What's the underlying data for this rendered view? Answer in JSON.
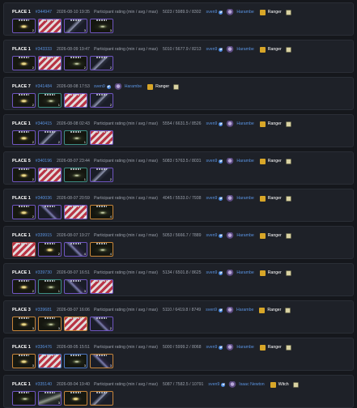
{
  "matches": [
    {
      "place": "PLACE 1",
      "id": "#344947",
      "date": "2026-08-10 19:35",
      "rating_label": "Participant rating (min / avg / max)",
      "rating": "5023 / 5989.9 / 8302",
      "user": "sven9",
      "team": "Harambe",
      "role": "Ranger",
      "items": [
        {
          "kind": "eye",
          "border": "purple",
          "count": "2"
        },
        {
          "kind": "flag",
          "border": "purple",
          "count": ""
        },
        {
          "kind": "blade",
          "border": "purple",
          "count": "3"
        },
        {
          "kind": "scope",
          "border": "purple",
          "count": "3"
        }
      ]
    },
    {
      "place": "PLACE 1",
      "id": "#343333",
      "date": "2026-08-09 19:47",
      "rating_label": "Participant rating (min / avg / max)",
      "rating": "5010 / 5677.9 / 8213",
      "user": "sven9",
      "team": "Harambe",
      "role": "Ranger",
      "items": [
        {
          "kind": "eye",
          "border": "purple",
          "count": "2"
        },
        {
          "kind": "flag",
          "border": "purple",
          "count": ""
        },
        {
          "kind": "scope",
          "border": "purple",
          "count": "2"
        },
        {
          "kind": "blade",
          "border": "purple",
          "count": "2"
        }
      ]
    },
    {
      "place": "PLACE 7",
      "id": "#341484",
      "date": "2026-08-08 17:53",
      "rating_label": "",
      "rating": "",
      "user": "sven9",
      "team": "Harambe",
      "role": "Ranger",
      "items": [
        {
          "kind": "eye",
          "border": "purple",
          "count": "2"
        },
        {
          "kind": "scope",
          "border": "teal",
          "count": "1"
        },
        {
          "kind": "flag",
          "border": "purple",
          "count": ""
        },
        {
          "kind": "blade",
          "border": "purple",
          "count": "2"
        }
      ]
    },
    {
      "place": "PLACE 1",
      "id": "#340415",
      "date": "2026-08-08 02:43",
      "rating_label": "Participant rating (min / avg / max)",
      "rating": "5554 / 6631.5 / 8526",
      "user": "sven9",
      "team": "Harambe",
      "role": "Ranger",
      "items": [
        {
          "kind": "eye",
          "border": "purple",
          "count": "2"
        },
        {
          "kind": "blade",
          "border": "purple",
          "count": "2"
        },
        {
          "kind": "scope",
          "border": "teal",
          "count": "1"
        },
        {
          "kind": "flag",
          "border": "purple",
          "count": "3"
        }
      ]
    },
    {
      "place": "PLACE 5",
      "id": "#340196",
      "date": "2026-08-07 23:44",
      "rating_label": "Participant rating (min / avg / max)",
      "rating": "5083 / 5763.5 / 8031",
      "user": "sven9",
      "team": "Harambe",
      "role": "Ranger",
      "items": [
        {
          "kind": "eye",
          "border": "purple",
          "count": "2"
        },
        {
          "kind": "flag",
          "border": "purple",
          "count": ""
        },
        {
          "kind": "scope",
          "border": "teal",
          "count": "1"
        },
        {
          "kind": "blade",
          "border": "purple",
          "count": "2"
        }
      ]
    },
    {
      "place": "PLACE 1",
      "id": "#340036",
      "date": "2026-08-07 20:59",
      "rating_label": "Participant rating (min / avg / max)",
      "rating": "4045 / 5533.0 / 7938",
      "user": "sven9",
      "team": "Harambe",
      "role": "Ranger",
      "items": [
        {
          "kind": "eye",
          "border": "purple",
          "count": "2"
        },
        {
          "kind": "blade2",
          "border": "purple",
          "count": ""
        },
        {
          "kind": "flag",
          "border": "purple",
          "count": "3"
        },
        {
          "kind": "scope",
          "border": "orange",
          "count": "4"
        }
      ]
    },
    {
      "place": "PLACE 1",
      "id": "#339915",
      "date": "2026-08-07 19:27",
      "rating_label": "Participant rating (min / avg / max)",
      "rating": "5053 / 5666.7 / 7889",
      "user": "sven9",
      "team": "Harambe",
      "role": "Ranger",
      "items": [
        {
          "kind": "flag",
          "border": "red",
          "count": ""
        },
        {
          "kind": "eye",
          "border": "purple",
          "count": "2"
        },
        {
          "kind": "blade2",
          "border": "purple",
          "count": "4"
        },
        {
          "kind": "scope",
          "border": "orange",
          "count": "4"
        }
      ]
    },
    {
      "place": "PLACE 1",
      "id": "#339730",
      "date": "2026-08-07 16:51",
      "rating_label": "Participant rating (min / avg / max)",
      "rating": "5134 / 6501.8 / 8625",
      "user": "sven9",
      "team": "Harambe",
      "role": "Ranger",
      "items": [
        {
          "kind": "eye",
          "border": "purple",
          "count": "2"
        },
        {
          "kind": "scope",
          "border": "teal",
          "count": "1"
        },
        {
          "kind": "blade2",
          "border": "purple",
          "count": "3"
        },
        {
          "kind": "flag",
          "border": "purple",
          "count": ""
        }
      ]
    },
    {
      "place": "PLACE 3",
      "id": "#339681",
      "date": "2026-08-07 16:06",
      "rating_label": "Participant rating (min / avg / max)",
      "rating": "5110 / 6419.8 / 8749",
      "user": "sven9",
      "team": "Harambe",
      "role": "Ranger",
      "items": [
        {
          "kind": "eye",
          "border": "orange",
          "count": "3"
        },
        {
          "kind": "scope",
          "border": "orange",
          "count": "3"
        },
        {
          "kind": "flag",
          "border": "orange",
          "count": ""
        },
        {
          "kind": "blade2",
          "border": "purple",
          "count": "2"
        }
      ]
    },
    {
      "place": "PLACE 1",
      "id": "#336476",
      "date": "2026-08-05 15:51",
      "rating_label": "Participant rating (min / avg / max)",
      "rating": "5000 / 5999.2 / 8068",
      "user": "sven9",
      "team": "Harambe",
      "role": "Ranger",
      "items": [
        {
          "kind": "eye",
          "border": "orange",
          "count": "3"
        },
        {
          "kind": "flag",
          "border": "blue",
          "count": ""
        },
        {
          "kind": "scope",
          "border": "blue",
          "count": "3"
        },
        {
          "kind": "blade2",
          "border": "orange",
          "count": "3"
        }
      ]
    },
    {
      "place": "PLACE 1",
      "id": "#335140",
      "date": "2026-08-04 19:40",
      "rating_label": "Participant rating (min / avg / max)",
      "rating": "5087 / 7582.5 / 10791",
      "user": "sven9",
      "team": "Isaac Newton",
      "role": "Witch",
      "items": [
        {
          "kind": "scope",
          "border": "purple",
          "count": ""
        },
        {
          "kind": "horn",
          "border": "purple",
          "count": "3"
        },
        {
          "kind": "eye",
          "border": "orange",
          "count": ""
        },
        {
          "kind": "blade",
          "border": "orange",
          "count": ""
        }
      ]
    }
  ]
}
